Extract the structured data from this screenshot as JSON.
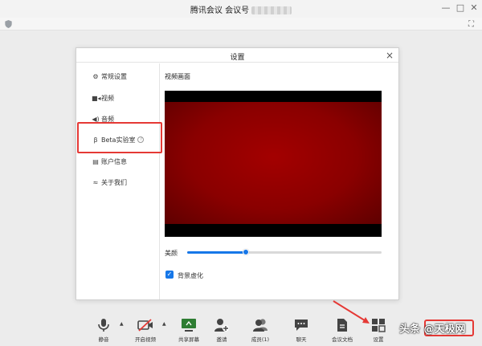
{
  "window": {
    "title": "腾讯会议 会议号",
    "controls": {
      "minimize": "—",
      "maximize": "□",
      "close": "✕"
    },
    "fullscreen_glyph": "⛶"
  },
  "dialog": {
    "title": "设置",
    "close": "×",
    "nav": [
      {
        "label": "常规设置",
        "icon": "gear-icon",
        "glyph": "⚙"
      },
      {
        "label": "视频",
        "icon": "camera-icon",
        "glyph": "■◂"
      },
      {
        "label": "音频",
        "icon": "speaker-icon",
        "glyph": "◀)"
      },
      {
        "label": "Beta实验室",
        "icon": "beta-lab-icon",
        "glyph": "β",
        "help": "?"
      },
      {
        "label": "账户信息",
        "icon": "account-card-icon",
        "glyph": "▤"
      },
      {
        "label": "关于我们",
        "icon": "about-icon",
        "glyph": "≈"
      }
    ],
    "highlighted_nav": "Beta实验室",
    "video": {
      "section_label": "视频画面",
      "beauty_label": "美颜",
      "beauty_level": 0.3,
      "background_blur_label": "背景虚化",
      "background_blur_checked": true
    }
  },
  "toolbar": {
    "items": [
      {
        "label": "静音",
        "icon": "microphone-icon"
      },
      {
        "label": "开启视频",
        "icon": "camera-off-icon"
      },
      {
        "label": "共享屏幕",
        "icon": "share-screen-icon"
      },
      {
        "label": "邀请",
        "icon": "invite-icon"
      },
      {
        "label": "成员(1)",
        "icon": "members-icon"
      },
      {
        "label": "聊天",
        "icon": "chat-icon"
      },
      {
        "label": "会议文档",
        "icon": "document-icon"
      },
      {
        "label": "设置",
        "icon": "settings-grid-icon"
      }
    ]
  },
  "watermark": {
    "text": "头条 @天极网"
  },
  "colors": {
    "accent": "#1677e8",
    "highlight": "#e53935",
    "preview_red": "#8a0000",
    "share_green": "#2e7d32"
  }
}
